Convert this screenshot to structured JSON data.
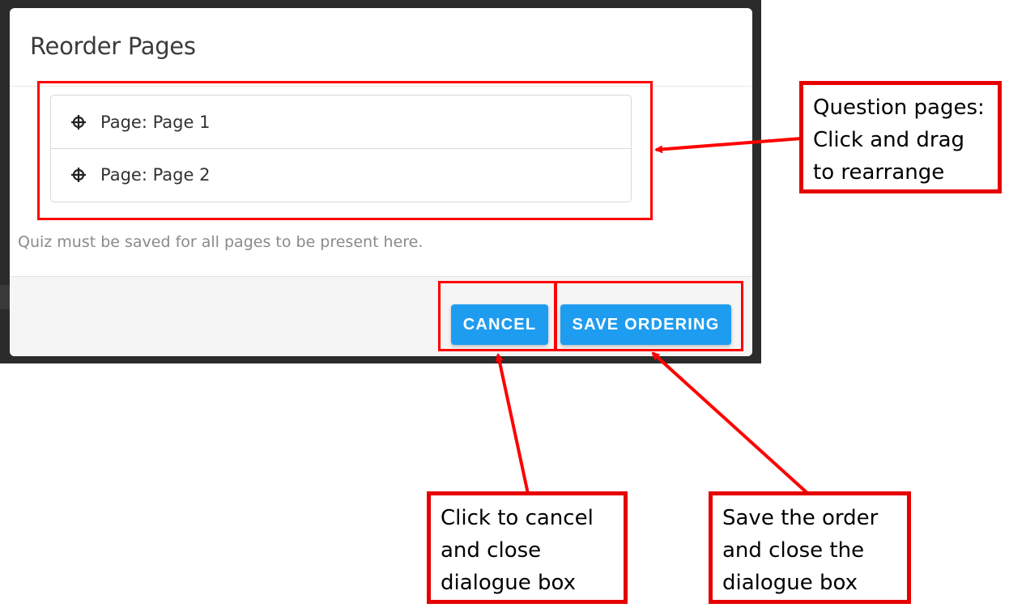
{
  "dialog": {
    "title": "Reorder Pages",
    "pages": [
      {
        "label": "Page: Page 1",
        "icon": "move-crosshair-icon"
      },
      {
        "label": "Page: Page 2",
        "icon": "move-crosshair-icon"
      }
    ],
    "hint": "Quiz must be saved for all pages to be present here.",
    "buttons": {
      "cancel": "CANCEL",
      "save": "SAVE ORDERING"
    },
    "accent_color": "#1e9cf0"
  },
  "annotations": {
    "color": "#ff0000",
    "pages_callout": [
      "Question pages:",
      "Click and drag",
      "to rearrange"
    ],
    "cancel_callout": [
      "Click to cancel",
      "and close",
      "dialogue box"
    ],
    "save_callout": [
      "Save the order",
      "and close the",
      "dialogue box"
    ]
  }
}
